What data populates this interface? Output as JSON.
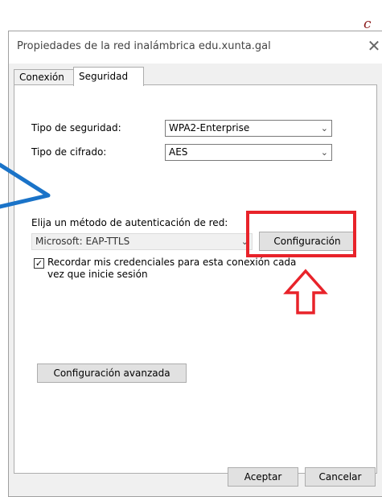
{
  "window": {
    "title": "Propiedades de la red inalámbrica edu.xunta.gal",
    "close_glyph": "✕"
  },
  "tabs": [
    {
      "label": "Conexión",
      "active": false
    },
    {
      "label": "Seguridad",
      "active": true
    }
  ],
  "security": {
    "security_type_label": "Tipo de seguridad:",
    "security_type_value": "WPA2-Enterprise",
    "cipher_type_label": "Tipo de cifrado:",
    "cipher_type_value": "AES"
  },
  "auth": {
    "method_label": "Elija un método de autenticación de red:",
    "method_value": "Microsoft: EAP-TTLS",
    "settings_button": "Configuración",
    "remember_checked": true,
    "remember_label_line1": "Recordar mis credenciales para esta conexión cada",
    "remember_label_line2": "vez que inicie sesión"
  },
  "advanced_button": "Configuración avanzada",
  "footer": {
    "accept_button": "Aceptar",
    "cancel_button": "Cancelar"
  },
  "overlay": {
    "stray_text": "c",
    "highlight_color": "#e8232a",
    "pointer_arrow_color": "#1a73c8"
  },
  "icons": {
    "dropdown": "chevron-down-icon",
    "checkbox_check": "checkmark-icon",
    "close": "close-icon"
  }
}
